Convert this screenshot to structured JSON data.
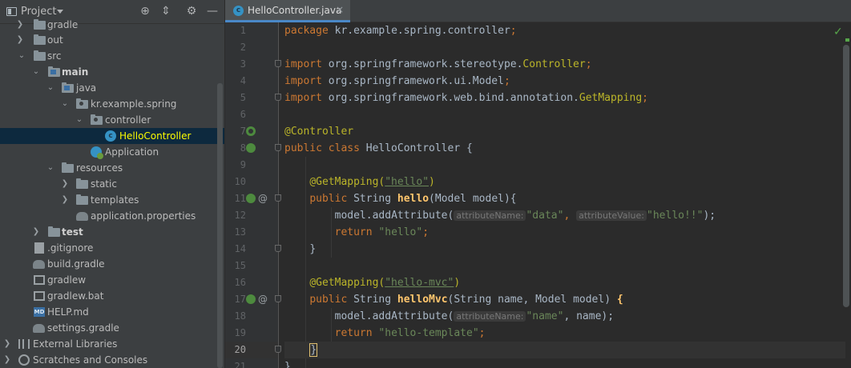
{
  "project_panel": {
    "title": "Project",
    "header_buttons": [
      "crosshair-icon",
      "collapse-icon",
      "gear-icon",
      "minimize-icon"
    ],
    "tree": [
      {
        "label": "gradle",
        "icon": "folder-icon",
        "expanded": false
      },
      {
        "label": "out",
        "icon": "folder-icon",
        "expanded": false
      },
      {
        "label": "src",
        "icon": "folder-icon",
        "expanded": true
      },
      {
        "label": "main",
        "icon": "module-folder-icon",
        "expanded": true
      },
      {
        "label": "java",
        "icon": "source-folder-icon",
        "expanded": true
      },
      {
        "label": "kr.example.spring",
        "icon": "package-icon",
        "expanded": true
      },
      {
        "label": "controller",
        "icon": "package-icon",
        "expanded": true
      },
      {
        "label": "HelloController",
        "icon": "class-icon",
        "selected": true
      },
      {
        "label": "Application",
        "icon": "spring-boot-class-icon"
      },
      {
        "label": "resources",
        "icon": "resources-folder-icon",
        "expanded": true
      },
      {
        "label": "static",
        "icon": "folder-icon",
        "expanded": false
      },
      {
        "label": "templates",
        "icon": "folder-icon",
        "expanded": false
      },
      {
        "label": "application.properties",
        "icon": "properties-file-icon"
      },
      {
        "label": "test",
        "icon": "module-folder-icon",
        "expanded": false
      },
      {
        "label": ".gitignore",
        "icon": "file-icon"
      },
      {
        "label": "build.gradle",
        "icon": "gradle-icon"
      },
      {
        "label": "gradlew",
        "icon": "terminal-file-icon"
      },
      {
        "label": "gradlew.bat",
        "icon": "terminal-file-icon"
      },
      {
        "label": "HELP.md",
        "icon": "markdown-file-icon"
      },
      {
        "label": "settings.gradle",
        "icon": "gradle-icon"
      },
      {
        "label": "External Libraries",
        "icon": "library-icon",
        "expanded": false
      },
      {
        "label": "Scratches and Consoles",
        "icon": "scratches-icon",
        "expanded": false
      }
    ]
  },
  "editor": {
    "tab": {
      "label": "HelloController.java",
      "close": "×",
      "icon_letter": "c"
    },
    "inspection_status": "✓",
    "current_line": 20,
    "line_numbers": [
      "1",
      "2",
      "3",
      "4",
      "5",
      "6",
      "7",
      "8",
      "9",
      "10",
      "11",
      "12",
      "13",
      "14",
      "15",
      "16",
      "17",
      "18",
      "19",
      "20",
      "21"
    ],
    "code": {
      "l1_kw": "package",
      "l1_rest": " kr.example.spring.controller",
      "l1_semi": ";",
      "l3_kw": "import",
      "l3_rest": " org.springframework.stereotype.",
      "l3_cls": "Controller",
      "l3_semi": ";",
      "l4_kw": "import",
      "l4_rest": " org.springframework.ui.Model",
      "l4_semi": ";",
      "l5_kw": "import",
      "l5_rest": " org.springframework.web.bind.annotation.",
      "l5_cls": "GetMapping",
      "l5_semi": ";",
      "l7_ann": "@Controller",
      "l8_kw": "public class",
      "l8_rest": " HelloController {",
      "l10_ann": "@GetMapping(",
      "l10_str": "\"hello\"",
      "l10_close": ")",
      "l11_kw": "public",
      "l11_rest1": " String ",
      "l11_fn": "hello",
      "l11_rest2": "(Model model){",
      "l12_call": "model.addAttribute(",
      "l12_hint1": "attributeName:",
      "l12_str1": "\"data\"",
      "l12_comma": ",",
      "l12_hint2": "attributeValue:",
      "l12_str2": "\"hello!!\"",
      "l12_end": ");",
      "l13_kw": "return",
      "l13_str": " \"hello\"",
      "l13_semi": ";",
      "l14_brace": "}",
      "l16_ann": "@GetMapping(",
      "l16_str": "\"hello-mvc\"",
      "l16_close": ")",
      "l17_kw": "public",
      "l17_rest1": " String ",
      "l17_fn": "helloMvc",
      "l17_rest2": "(String name, Model model) ",
      "l17_brace": "{",
      "l18_call": "model.addAttribute(",
      "l18_hint": "attributeName:",
      "l18_str": "\"name\"",
      "l18_rest": ", name);",
      "l19_kw": "return",
      "l19_str": " \"hello-template\"",
      "l19_semi": ";",
      "l20_brace": "}",
      "l21_brace": "}"
    }
  },
  "colors": {
    "keyword": "#cc7832",
    "annotation": "#bbb529",
    "string": "#6a8759",
    "method": "#ffc66d",
    "text": "#a9b7c6",
    "selection": "#0d293e"
  }
}
